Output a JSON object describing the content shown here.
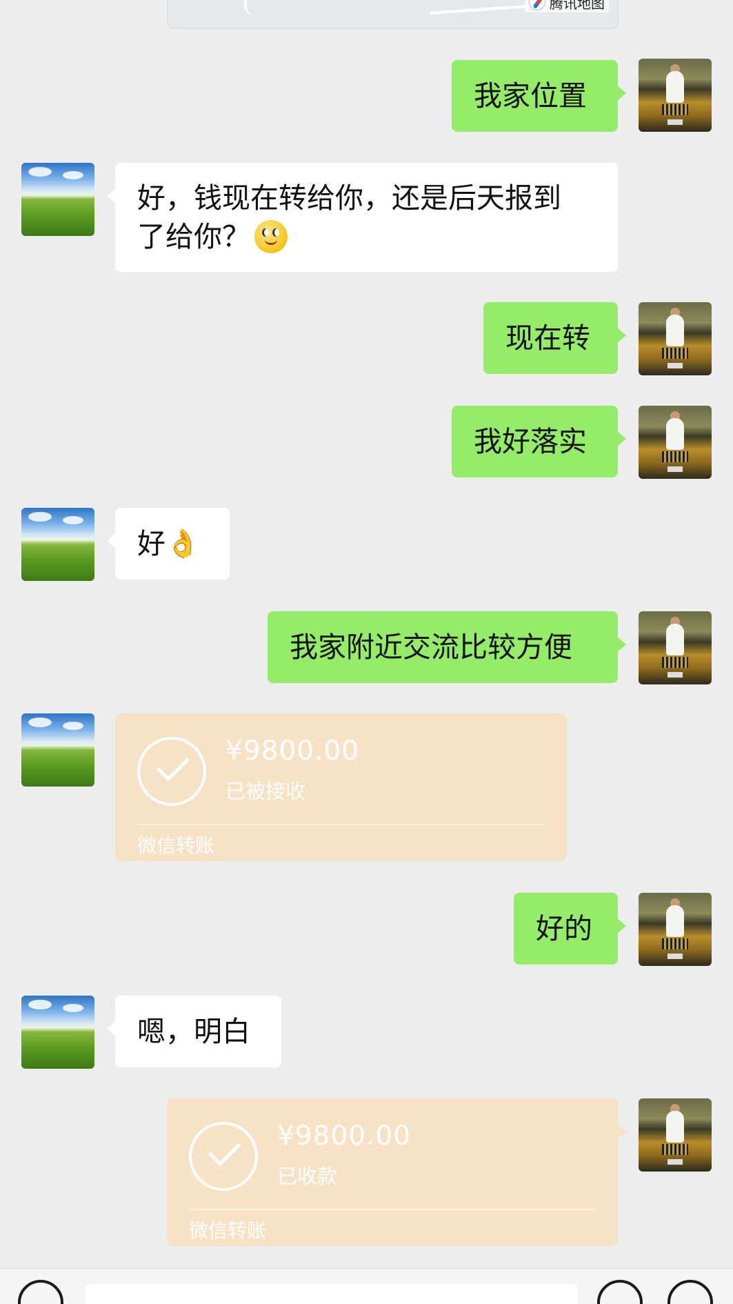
{
  "map_card": {
    "provider": "腾讯地图",
    "icon": "compass-icon"
  },
  "messages": [
    {
      "side": "right",
      "type": "text",
      "text": "我家位置"
    },
    {
      "side": "left",
      "type": "text",
      "text_line1": "好，钱现在转给你，还是后天报到",
      "text_line2": "了给你？",
      "emoji": "smile-emoji"
    },
    {
      "side": "right",
      "type": "text",
      "text": "现在转"
    },
    {
      "side": "right",
      "type": "text",
      "text": "我好落实"
    },
    {
      "side": "left",
      "type": "text",
      "text": "好",
      "emoji": "👌"
    },
    {
      "side": "right",
      "type": "text",
      "text": "我家附近交流比较方便"
    },
    {
      "side": "left",
      "type": "transfer",
      "amount": "¥9800.00",
      "status": "已被接收",
      "label": "微信转账"
    },
    {
      "side": "right",
      "type": "text",
      "text": "好的"
    },
    {
      "side": "left",
      "type": "text",
      "text": "嗯，明白"
    },
    {
      "side": "right",
      "type": "transfer",
      "amount": "¥9800.00",
      "status": "已收款",
      "label": "微信转账"
    }
  ],
  "colors": {
    "background": "#ededed",
    "bubble_sent": "#95ec69",
    "bubble_received": "#ffffff",
    "transfer_card": "#f8e2c6"
  },
  "input_bar": {
    "placeholder": ""
  }
}
